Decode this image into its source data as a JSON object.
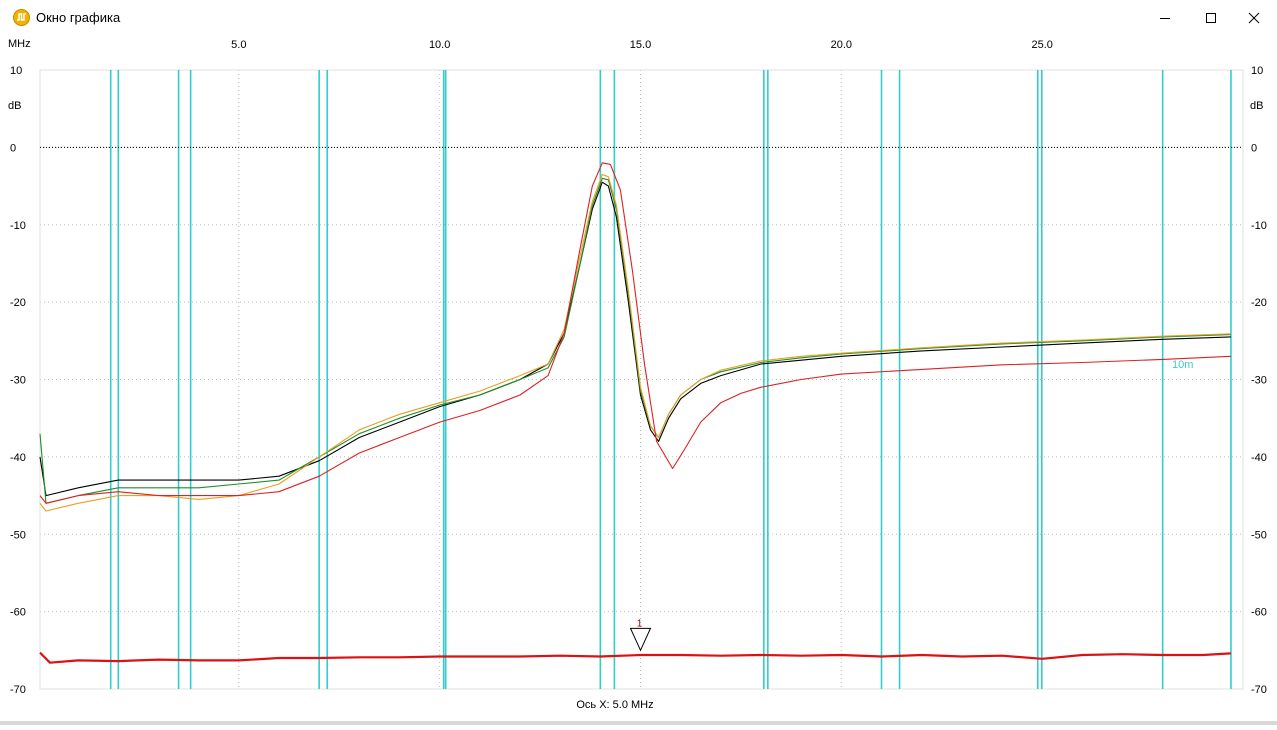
{
  "window": {
    "title": "Окно графика",
    "controls": {
      "minimize": "minimize",
      "maximize": "maximize",
      "close": "close"
    }
  },
  "chart_data": {
    "type": "line",
    "title": "",
    "x_unit": "MHz",
    "y_unit": "dB",
    "xlabel_bottom": "Ось X: 5.0 MHz",
    "xlim": [
      0.05,
      30.0
    ],
    "ylim": [
      -70,
      10
    ],
    "x_ticks": [
      5.0,
      10.0,
      15.0,
      20.0,
      25.0
    ],
    "x_tick_labels": [
      "5.0",
      "10.0",
      "15.0",
      "20.0",
      "25.0"
    ],
    "y_ticks": [
      10,
      0,
      -10,
      -20,
      -30,
      -40,
      -50,
      -60,
      -70
    ],
    "y_tick_labels": [
      "10",
      "0",
      "-10",
      "-20",
      "-30",
      "-40",
      "-50",
      "-60",
      "-70"
    ],
    "reference_line_db": 0,
    "grid": true,
    "band_markers_mhz": [
      1.81,
      2.0,
      3.5,
      3.8,
      7.0,
      7.2,
      10.1,
      10.15,
      14.0,
      14.35,
      18.07,
      18.17,
      21.0,
      21.45,
      24.89,
      24.99,
      28.0,
      29.7
    ],
    "band_label": {
      "text": "10m",
      "x": 28.5,
      "y": -28
    },
    "marker": {
      "label": "1",
      "x": 15.0,
      "y": -65
    },
    "colors": {
      "band": "#33cccc",
      "black": "#000000",
      "green": "#1f8f2a",
      "orange": "#e8a020",
      "red": "#dd2222",
      "noise": "#dd1111"
    },
    "series": [
      {
        "color_key": "black",
        "x": [
          0.05,
          0.2,
          1,
          2,
          3,
          4,
          5,
          6,
          7,
          8,
          9,
          10,
          11,
          12,
          12.7,
          13.1,
          13.5,
          13.8,
          14.05,
          14.2,
          14.4,
          14.7,
          15.0,
          15.25,
          15.45,
          15.7,
          16.0,
          16.5,
          17,
          18,
          19,
          20,
          22,
          24,
          26,
          28,
          29.7
        ],
        "y": [
          -40,
          -45,
          -44,
          -43,
          -43,
          -43,
          -43,
          -42.5,
          -40.5,
          -37.5,
          -35.5,
          -33.5,
          -32,
          -30,
          -28,
          -24,
          -15,
          -8,
          -4.5,
          -5,
          -9,
          -20,
          -32,
          -36.5,
          -38,
          -35,
          -32.5,
          -30.5,
          -29.5,
          -28,
          -27.5,
          -27,
          -26.3,
          -25.8,
          -25.3,
          -24.8,
          -24.5
        ]
      },
      {
        "color_key": "green",
        "x": [
          0.05,
          0.2,
          1,
          2,
          3,
          4,
          5,
          6,
          7,
          8,
          9,
          10,
          11,
          12,
          12.7,
          13.1,
          13.5,
          13.8,
          14.05,
          14.2,
          14.4,
          14.7,
          15.0,
          15.25,
          15.45,
          15.7,
          16.0,
          16.5,
          17,
          18,
          19,
          20,
          22,
          24,
          26,
          28,
          29.7
        ],
        "y": [
          -37,
          -46,
          -45,
          -44,
          -44,
          -44,
          -43.5,
          -43,
          -40,
          -37,
          -35,
          -33.3,
          -32,
          -30,
          -28.5,
          -24.5,
          -15,
          -7.5,
          -4,
          -4.2,
          -8,
          -19,
          -31.5,
          -36,
          -37.5,
          -34.5,
          -32,
          -30,
          -29,
          -27.8,
          -27.2,
          -26.7,
          -26,
          -25.4,
          -25,
          -24.5,
          -24.2
        ]
      },
      {
        "color_key": "orange",
        "x": [
          0.05,
          0.2,
          1,
          2,
          3,
          4,
          5,
          6,
          7,
          8,
          9,
          10,
          11,
          12,
          12.7,
          13.1,
          13.5,
          13.8,
          14.05,
          14.2,
          14.4,
          14.7,
          15.0,
          15.25,
          15.45,
          15.7,
          16.0,
          16.5,
          17,
          18,
          19,
          20,
          22,
          24,
          26,
          28,
          29.7
        ],
        "y": [
          -46,
          -47,
          -46,
          -45,
          -45,
          -45.5,
          -45,
          -43.5,
          -40,
          -36.5,
          -34.5,
          -33,
          -31.5,
          -29.5,
          -28,
          -23.5,
          -14,
          -7,
          -3.5,
          -3.8,
          -7.5,
          -18.5,
          -31,
          -36,
          -37.5,
          -34.5,
          -32,
          -30,
          -28.8,
          -27.6,
          -27,
          -26.6,
          -25.9,
          -25.3,
          -24.9,
          -24.4,
          -24.1
        ]
      },
      {
        "color_key": "red",
        "x": [
          0.05,
          0.2,
          1,
          2,
          3,
          4,
          5,
          6,
          7,
          8,
          9,
          10,
          11,
          12,
          12.7,
          13.1,
          13.5,
          13.8,
          14.05,
          14.25,
          14.5,
          14.8,
          15.1,
          15.4,
          15.8,
          16.1,
          16.5,
          17,
          17.5,
          18,
          19,
          20,
          22,
          24,
          26,
          28,
          29.7
        ],
        "y": [
          -45,
          -46,
          -45,
          -44.5,
          -45,
          -45,
          -45,
          -44.5,
          -42.5,
          -39.5,
          -37.5,
          -35.5,
          -34,
          -32,
          -29.5,
          -24,
          -13,
          -5,
          -2,
          -2.2,
          -5.5,
          -16,
          -28,
          -38,
          -41.5,
          -39,
          -35.5,
          -33,
          -31.8,
          -31,
          -30,
          -29.3,
          -28.7,
          -28.1,
          -27.8,
          -27.4,
          -27
        ]
      },
      {
        "color_key": "noise",
        "x": [
          0.05,
          0.3,
          1,
          2,
          3,
          4,
          5,
          6,
          7,
          8,
          9,
          10,
          11,
          12,
          13,
          14,
          15,
          16,
          17,
          18,
          19,
          20,
          21,
          22,
          23,
          24,
          25,
          26,
          27,
          28,
          29,
          29.7
        ],
        "y": [
          -65.3,
          -66.6,
          -66.3,
          -66.4,
          -66.2,
          -66.3,
          -66.3,
          -66.0,
          -66.0,
          -65.9,
          -65.9,
          -65.8,
          -65.8,
          -65.8,
          -65.7,
          -65.8,
          -65.6,
          -65.6,
          -65.7,
          -65.6,
          -65.7,
          -65.6,
          -65.8,
          -65.6,
          -65.8,
          -65.7,
          -66.1,
          -65.6,
          -65.5,
          -65.6,
          -65.6,
          -65.4
        ]
      }
    ]
  }
}
